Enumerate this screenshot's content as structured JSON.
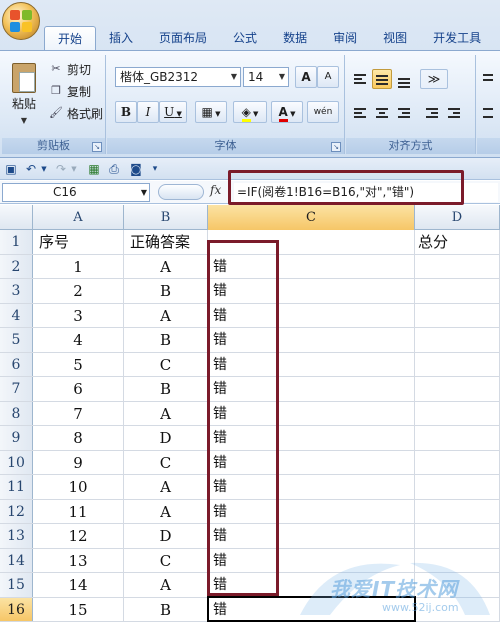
{
  "ribbon": {
    "tabs": [
      "开始",
      "插入",
      "页面布局",
      "公式",
      "数据",
      "审阅",
      "视图",
      "开发工具"
    ],
    "clipboard": {
      "paste": "粘贴",
      "cut": "剪切",
      "copy": "复制",
      "format_painter": "格式刷",
      "label": "剪贴板"
    },
    "font": {
      "name": "楷体_GB2312",
      "size": "14",
      "grow": "A",
      "shrink": "A",
      "bold": "B",
      "italic": "I",
      "underline": "U",
      "font_color": "A",
      "phonetic": "wén",
      "label": "字体"
    },
    "alignment": {
      "label": "对齐方式"
    }
  },
  "formula_bar": {
    "name_box": "C16",
    "fx": "fx",
    "formula": "=IF(阅卷1!B16=B16,\"对\",\"错\")"
  },
  "columns": [
    "A",
    "B",
    "C",
    "D"
  ],
  "selected_column": "C",
  "rows": [
    {
      "n": "1",
      "a": "序号",
      "b": "正确答案",
      "c": "",
      "d": "总分"
    },
    {
      "n": "2",
      "a": "1",
      "b": "A",
      "c": "错",
      "d": ""
    },
    {
      "n": "3",
      "a": "2",
      "b": "B",
      "c": "错",
      "d": ""
    },
    {
      "n": "4",
      "a": "3",
      "b": "A",
      "c": "错",
      "d": ""
    },
    {
      "n": "5",
      "a": "4",
      "b": "B",
      "c": "错",
      "d": ""
    },
    {
      "n": "6",
      "a": "5",
      "b": "C",
      "c": "错",
      "d": ""
    },
    {
      "n": "7",
      "a": "6",
      "b": "B",
      "c": "错",
      "d": ""
    },
    {
      "n": "8",
      "a": "7",
      "b": "A",
      "c": "错",
      "d": ""
    },
    {
      "n": "9",
      "a": "8",
      "b": "D",
      "c": "错",
      "d": ""
    },
    {
      "n": "10",
      "a": "9",
      "b": "C",
      "c": "错",
      "d": ""
    },
    {
      "n": "11",
      "a": "10",
      "b": "A",
      "c": "错",
      "d": ""
    },
    {
      "n": "12",
      "a": "11",
      "b": "A",
      "c": "错",
      "d": ""
    },
    {
      "n": "13",
      "a": "12",
      "b": "D",
      "c": "错",
      "d": ""
    },
    {
      "n": "14",
      "a": "13",
      "b": "C",
      "c": "错",
      "d": ""
    },
    {
      "n": "15",
      "a": "14",
      "b": "A",
      "c": "错",
      "d": ""
    },
    {
      "n": "16",
      "a": "15",
      "b": "B",
      "c": "错",
      "d": ""
    }
  ],
  "selected_row": "16",
  "watermark": {
    "text": "我爱IT技术网",
    "url": "www.52ij.com"
  },
  "colors": {
    "highlight": "#7b1b2a",
    "ribbon": "#dfe9f5",
    "selection": "#f6c667"
  }
}
